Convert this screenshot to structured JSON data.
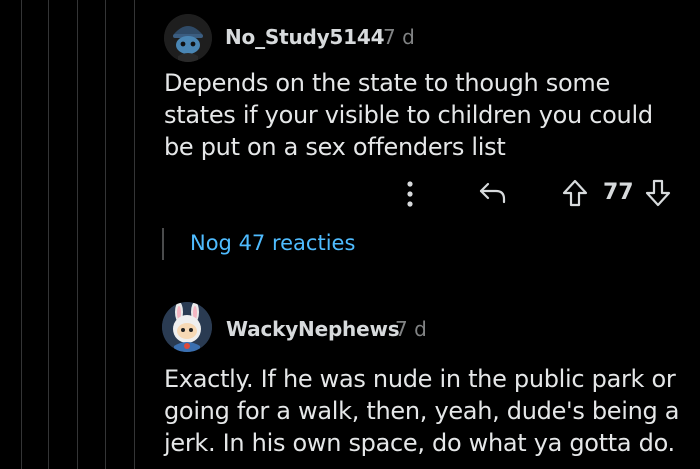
{
  "comments": [
    {
      "username": "No_Study5144",
      "age": "7 d",
      "avatar": "reddit-snoo-avatar-blue-hat",
      "lines": [
        "Depends on the state to though some",
        "states if your visible to children you could",
        "be put on a sex offenders list"
      ],
      "actions": {
        "more_icon": "vertical-dots-icon",
        "reply_icon": "reply-arrow-icon",
        "upvote_icon": "upvote-arrow-icon",
        "downvote_icon": "downvote-arrow-icon",
        "score": "77"
      },
      "more_replies_label": "Nog 47 reacties"
    },
    {
      "username": "WackyNephews",
      "age": "7 d",
      "avatar": "reddit-snoo-avatar-bunny-hood",
      "lines": [
        "Exactly. If he was nude in the public park or",
        "going for a walk, then, yeah, dude's being a",
        "jerk. In his own space, do what ya gotta do."
      ]
    }
  ],
  "colors": {
    "background": "#000000",
    "text": "#d7dadc",
    "muted": "#818384",
    "link": "#4fbcff",
    "thread_line": "#343536"
  }
}
